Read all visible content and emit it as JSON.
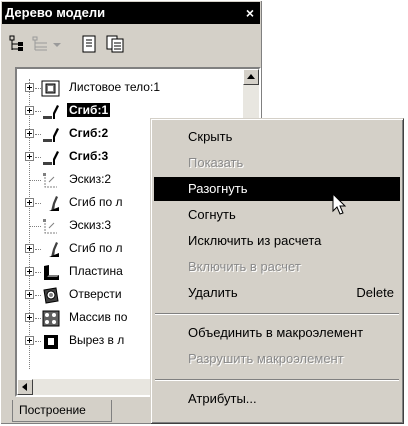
{
  "panel": {
    "title": "Дерево модели",
    "close_glyph": "×",
    "tab_label": "Построение"
  },
  "toolbar": {
    "icons": [
      "tree-view-icon",
      "tree-list-icon",
      "dropdown-arrow-icon",
      "page-icon",
      "pages-icon"
    ]
  },
  "tree": {
    "items": [
      {
        "label": "Листовое тело:1",
        "icon": "sheet-body-icon",
        "style": "normal"
      },
      {
        "label": "Сгиб:1",
        "icon": "bend-icon",
        "style": "selected"
      },
      {
        "label": "Сгиб:2",
        "icon": "bend-icon",
        "style": "bold"
      },
      {
        "label": "Сгиб:3",
        "icon": "bend-icon",
        "style": "bold"
      },
      {
        "label": "Эскиз:2",
        "icon": "sketch-icon",
        "style": "normal"
      },
      {
        "label": "Сгиб по л",
        "icon": "bend-by-line-icon",
        "style": "normal"
      },
      {
        "label": "Эскиз:3",
        "icon": "sketch-icon",
        "style": "normal"
      },
      {
        "label": "Сгиб по л",
        "icon": "bend-by-line-icon",
        "style": "normal"
      },
      {
        "label": "Пластина",
        "icon": "plate-icon",
        "style": "normal"
      },
      {
        "label": "Отверсти",
        "icon": "hole-icon",
        "style": "normal"
      },
      {
        "label": "Массив по",
        "icon": "array-icon",
        "style": "normal"
      },
      {
        "label": "Вырез в л",
        "icon": "cut-icon",
        "style": "normal"
      }
    ]
  },
  "context_menu": {
    "items": [
      {
        "label": "Скрыть",
        "state": "normal",
        "shortcut": ""
      },
      {
        "label": "Показать",
        "state": "disabled",
        "shortcut": ""
      },
      {
        "label": "Разогнуть",
        "state": "highlighted",
        "shortcut": ""
      },
      {
        "label": "Согнуть",
        "state": "normal",
        "shortcut": ""
      },
      {
        "label": "Исключить из расчета",
        "state": "normal",
        "shortcut": ""
      },
      {
        "label": "Включить в расчет",
        "state": "disabled",
        "shortcut": ""
      },
      {
        "label": "Удалить",
        "state": "normal",
        "shortcut": "Delete"
      },
      {
        "label": "Объединить в макроэлемент",
        "state": "normal",
        "shortcut": ""
      },
      {
        "label": "Разрушить макроэлемент",
        "state": "disabled",
        "shortcut": ""
      },
      {
        "label": "Атрибуты...",
        "state": "normal",
        "shortcut": ""
      }
    ]
  }
}
